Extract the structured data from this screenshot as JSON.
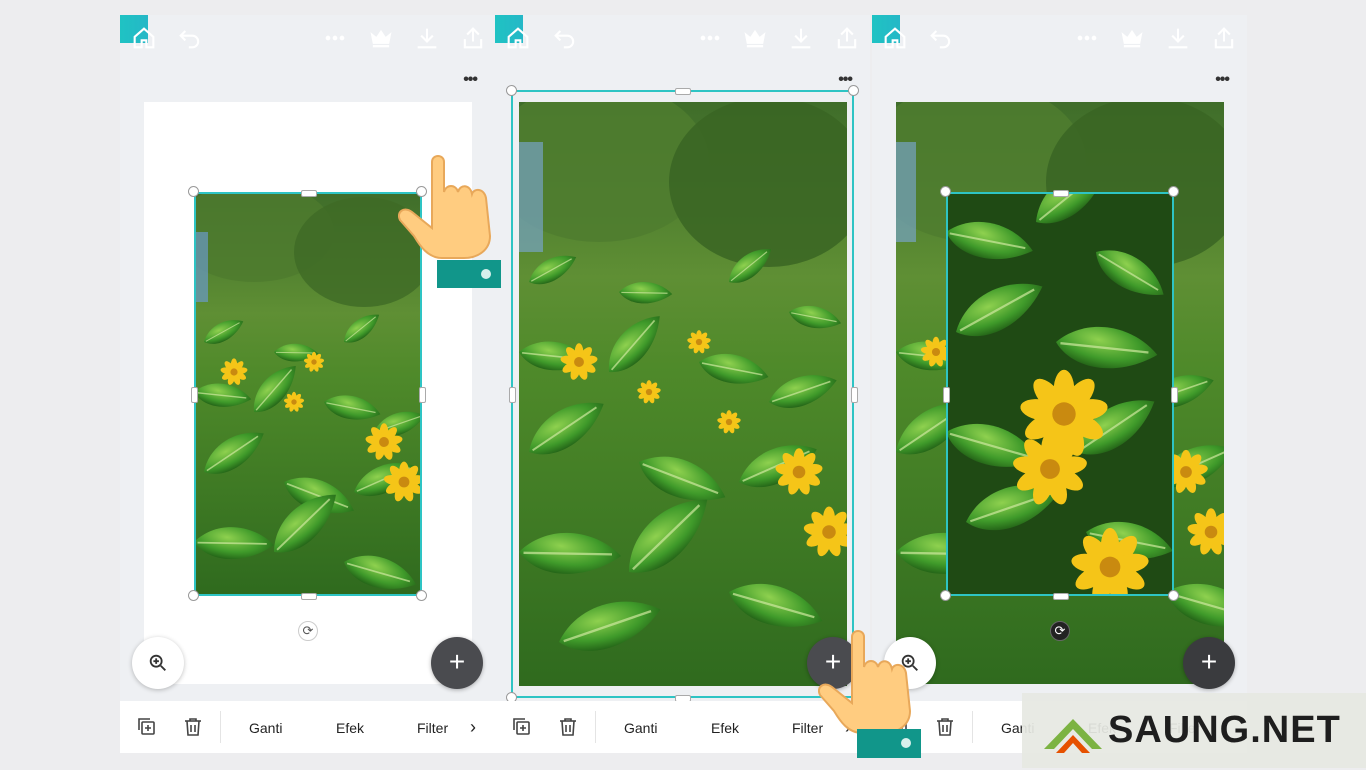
{
  "toolbar": {
    "icons": [
      "home-icon",
      "undo-icon",
      "more-icon",
      "crown-icon",
      "download-icon",
      "share-icon"
    ],
    "gradient": [
      "#1fc3c3",
      "#4a6ee0",
      "#7b3ff0"
    ]
  },
  "canvas": {
    "more_label": "•••",
    "add_label": "+",
    "rotate_label": "⟳"
  },
  "bottom_bar": {
    "replace_label": "Ganti",
    "effects_label": "Efek",
    "filter_label": "Filter",
    "next_label": "›"
  },
  "colors": {
    "selection": "#2ec4c4",
    "hand_skin": "#ffcc80",
    "hand_sleeve": "#11968a"
  },
  "watermark": {
    "text": "SAUNG.NET"
  }
}
